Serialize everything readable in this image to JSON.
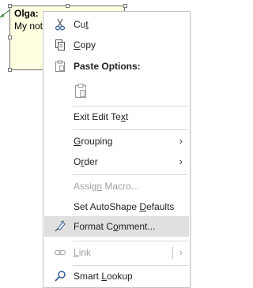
{
  "note": {
    "author": "Olga:",
    "text": "My not"
  },
  "menu": {
    "cut": {
      "pre": "Cu",
      "accel": "t",
      "post": ""
    },
    "copy": {
      "pre": "",
      "accel": "C",
      "post": "opy"
    },
    "paste_options": {
      "label": "Paste Options:"
    },
    "exit_edit": {
      "pre": "Exit Edit Te",
      "accel": "x",
      "post": "t"
    },
    "grouping": {
      "pre": "",
      "accel": "G",
      "post": "rouping"
    },
    "order": {
      "pre": "O",
      "accel": "r",
      "post": "der"
    },
    "assign_macro": {
      "pre": "Assig",
      "accel": "n",
      "post": " Macro..."
    },
    "set_defaults": {
      "pre": "Set AutoShape ",
      "accel": "D",
      "post": "efaults"
    },
    "format_comment": {
      "pre": "Format C",
      "accel": "o",
      "post": "mment..."
    },
    "link": {
      "pre": "",
      "accel": "L",
      "post": "ink"
    },
    "smart_lookup": {
      "pre": "Smart ",
      "accel": "L",
      "post": "ookup"
    }
  },
  "icons": {
    "cut": "scissors-icon",
    "copy": "copy-icon",
    "paste_header": "clipboard-icon",
    "paste": "paste-icon",
    "format_comment": "format-brush-icon",
    "link": "link-icon",
    "smart_lookup": "search-icon"
  },
  "colors": {
    "note_bg": "#ffffe1",
    "highlight": "#e0e0e0",
    "disabled_text": "#a0a0a0",
    "accent_blue": "#2b5797"
  }
}
